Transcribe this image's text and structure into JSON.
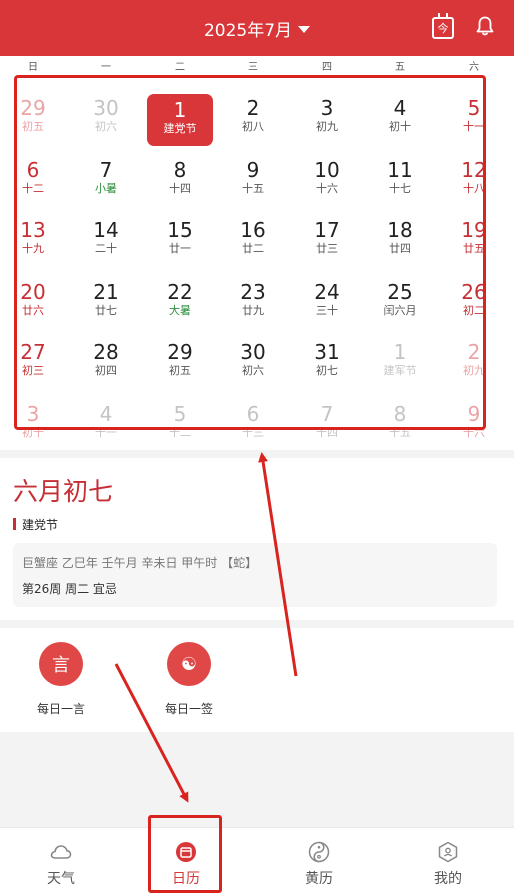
{
  "header": {
    "month_title": "2025年7月",
    "today_icon_text": "今"
  },
  "weekdays": [
    "日",
    "一",
    "二",
    "三",
    "四",
    "五",
    "六"
  ],
  "calendar": {
    "weeks": [
      [
        {
          "n": "29",
          "l": "初五",
          "other": true
        },
        {
          "n": "30",
          "l": "初六",
          "other": true
        },
        {
          "n": "1",
          "l": "建党节",
          "today": true
        },
        {
          "n": "2",
          "l": "初八"
        },
        {
          "n": "3",
          "l": "初九"
        },
        {
          "n": "4",
          "l": "初十"
        },
        {
          "n": "5",
          "l": "十一"
        }
      ],
      [
        {
          "n": "6",
          "l": "十二"
        },
        {
          "n": "7",
          "l": "小暑",
          "term": true
        },
        {
          "n": "8",
          "l": "十四"
        },
        {
          "n": "9",
          "l": "十五"
        },
        {
          "n": "10",
          "l": "十六"
        },
        {
          "n": "11",
          "l": "十七"
        },
        {
          "n": "12",
          "l": "十八"
        }
      ],
      [
        {
          "n": "13",
          "l": "十九"
        },
        {
          "n": "14",
          "l": "二十"
        },
        {
          "n": "15",
          "l": "廿一"
        },
        {
          "n": "16",
          "l": "廿二"
        },
        {
          "n": "17",
          "l": "廿三"
        },
        {
          "n": "18",
          "l": "廿四"
        },
        {
          "n": "19",
          "l": "廿五"
        }
      ],
      [
        {
          "n": "20",
          "l": "廿六"
        },
        {
          "n": "21",
          "l": "廿七"
        },
        {
          "n": "22",
          "l": "大暑",
          "term": true
        },
        {
          "n": "23",
          "l": "廿九"
        },
        {
          "n": "24",
          "l": "三十"
        },
        {
          "n": "25",
          "l": "闰六月"
        },
        {
          "n": "26",
          "l": "初二"
        }
      ],
      [
        {
          "n": "27",
          "l": "初三"
        },
        {
          "n": "28",
          "l": "初四"
        },
        {
          "n": "29",
          "l": "初五"
        },
        {
          "n": "30",
          "l": "初六"
        },
        {
          "n": "31",
          "l": "初七"
        },
        {
          "n": "1",
          "l": "建军节",
          "other": true
        },
        {
          "n": "2",
          "l": "初九",
          "other": true
        }
      ],
      [
        {
          "n": "3",
          "l": "初十",
          "other": true
        },
        {
          "n": "4",
          "l": "十一",
          "other": true
        },
        {
          "n": "5",
          "l": "十二",
          "other": true
        },
        {
          "n": "6",
          "l": "十三",
          "other": true
        },
        {
          "n": "7",
          "l": "十四",
          "other": true
        },
        {
          "n": "8",
          "l": "十五",
          "other": true
        },
        {
          "n": "9",
          "l": "十六",
          "other": true
        }
      ]
    ]
  },
  "info": {
    "lunar_date": "六月初七",
    "festival": "建党节",
    "ganzhi": "巨蟹座  乙巳年  壬午月  辛未日  甲午时  【蛇】",
    "week_line": "第26周 周二   宜忌"
  },
  "daily": [
    {
      "label": "每日一言",
      "icon": "quote-icon",
      "glyph": "言"
    },
    {
      "label": "每日一签",
      "icon": "fortune-icon",
      "glyph": "☯"
    }
  ],
  "nav": [
    {
      "label": "天气",
      "icon": "cloud-icon"
    },
    {
      "label": "日历",
      "icon": "calendar-icon",
      "active": true
    },
    {
      "label": "黄历",
      "icon": "yinyang-icon"
    },
    {
      "label": "我的",
      "icon": "profile-icon"
    }
  ],
  "colors": {
    "primary": "#d9363a",
    "weekend": "#c62f35",
    "term": "#2f8f3d",
    "annotation": "#d9231f"
  }
}
